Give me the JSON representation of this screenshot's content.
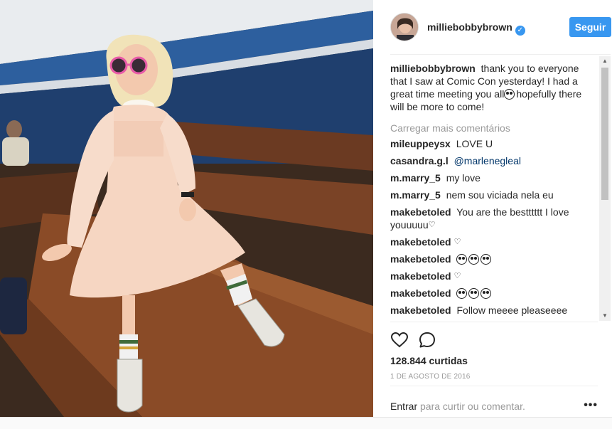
{
  "post": {
    "header_username": "milliebobbybrown",
    "verified_mark": "✓",
    "follow_label": "Seguir"
  },
  "caption": {
    "username": "milliebobbybrown",
    "text_before_emoji": "thank you to everyone that I saw at Comic Con yesterday! I had a great time meeting you all",
    "text_after_emoji": "hopefully there will be more to come!"
  },
  "load_more_label": "Carregar mais comentários",
  "comments": [
    {
      "username": "mileuppeysx",
      "text": "LOVE U"
    },
    {
      "username": "casandra.g.l",
      "mention": "@marlenegleal"
    },
    {
      "username": "m.marry_5",
      "text": "my love"
    },
    {
      "username": "m.marry_5",
      "text": "nem sou viciada nela eu"
    },
    {
      "username": "makebetoled",
      "text": "You are the bestttttt I love youuuuu"
    },
    {
      "username": "makebetoled"
    },
    {
      "username": "makebetoled"
    },
    {
      "username": "makebetoled"
    },
    {
      "username": "makebetoled"
    },
    {
      "username": "makebetoled",
      "text": "Follow meeee pleaseeee"
    }
  ],
  "icons": {
    "like": "heart-icon",
    "comment": "comment-bubble-icon",
    "more": "more-options-icon",
    "verified": "verified-badge-icon"
  },
  "likes_text": "128.844 curtidas",
  "date_text": "1 DE AGOSTO DE 2016",
  "footer": {
    "login_link": "Entrar",
    "rest": " para curtir ou comentar.",
    "more_label": "•••"
  },
  "colors": {
    "accent": "#3897f0",
    "muted": "#999999",
    "text": "#262626"
  }
}
